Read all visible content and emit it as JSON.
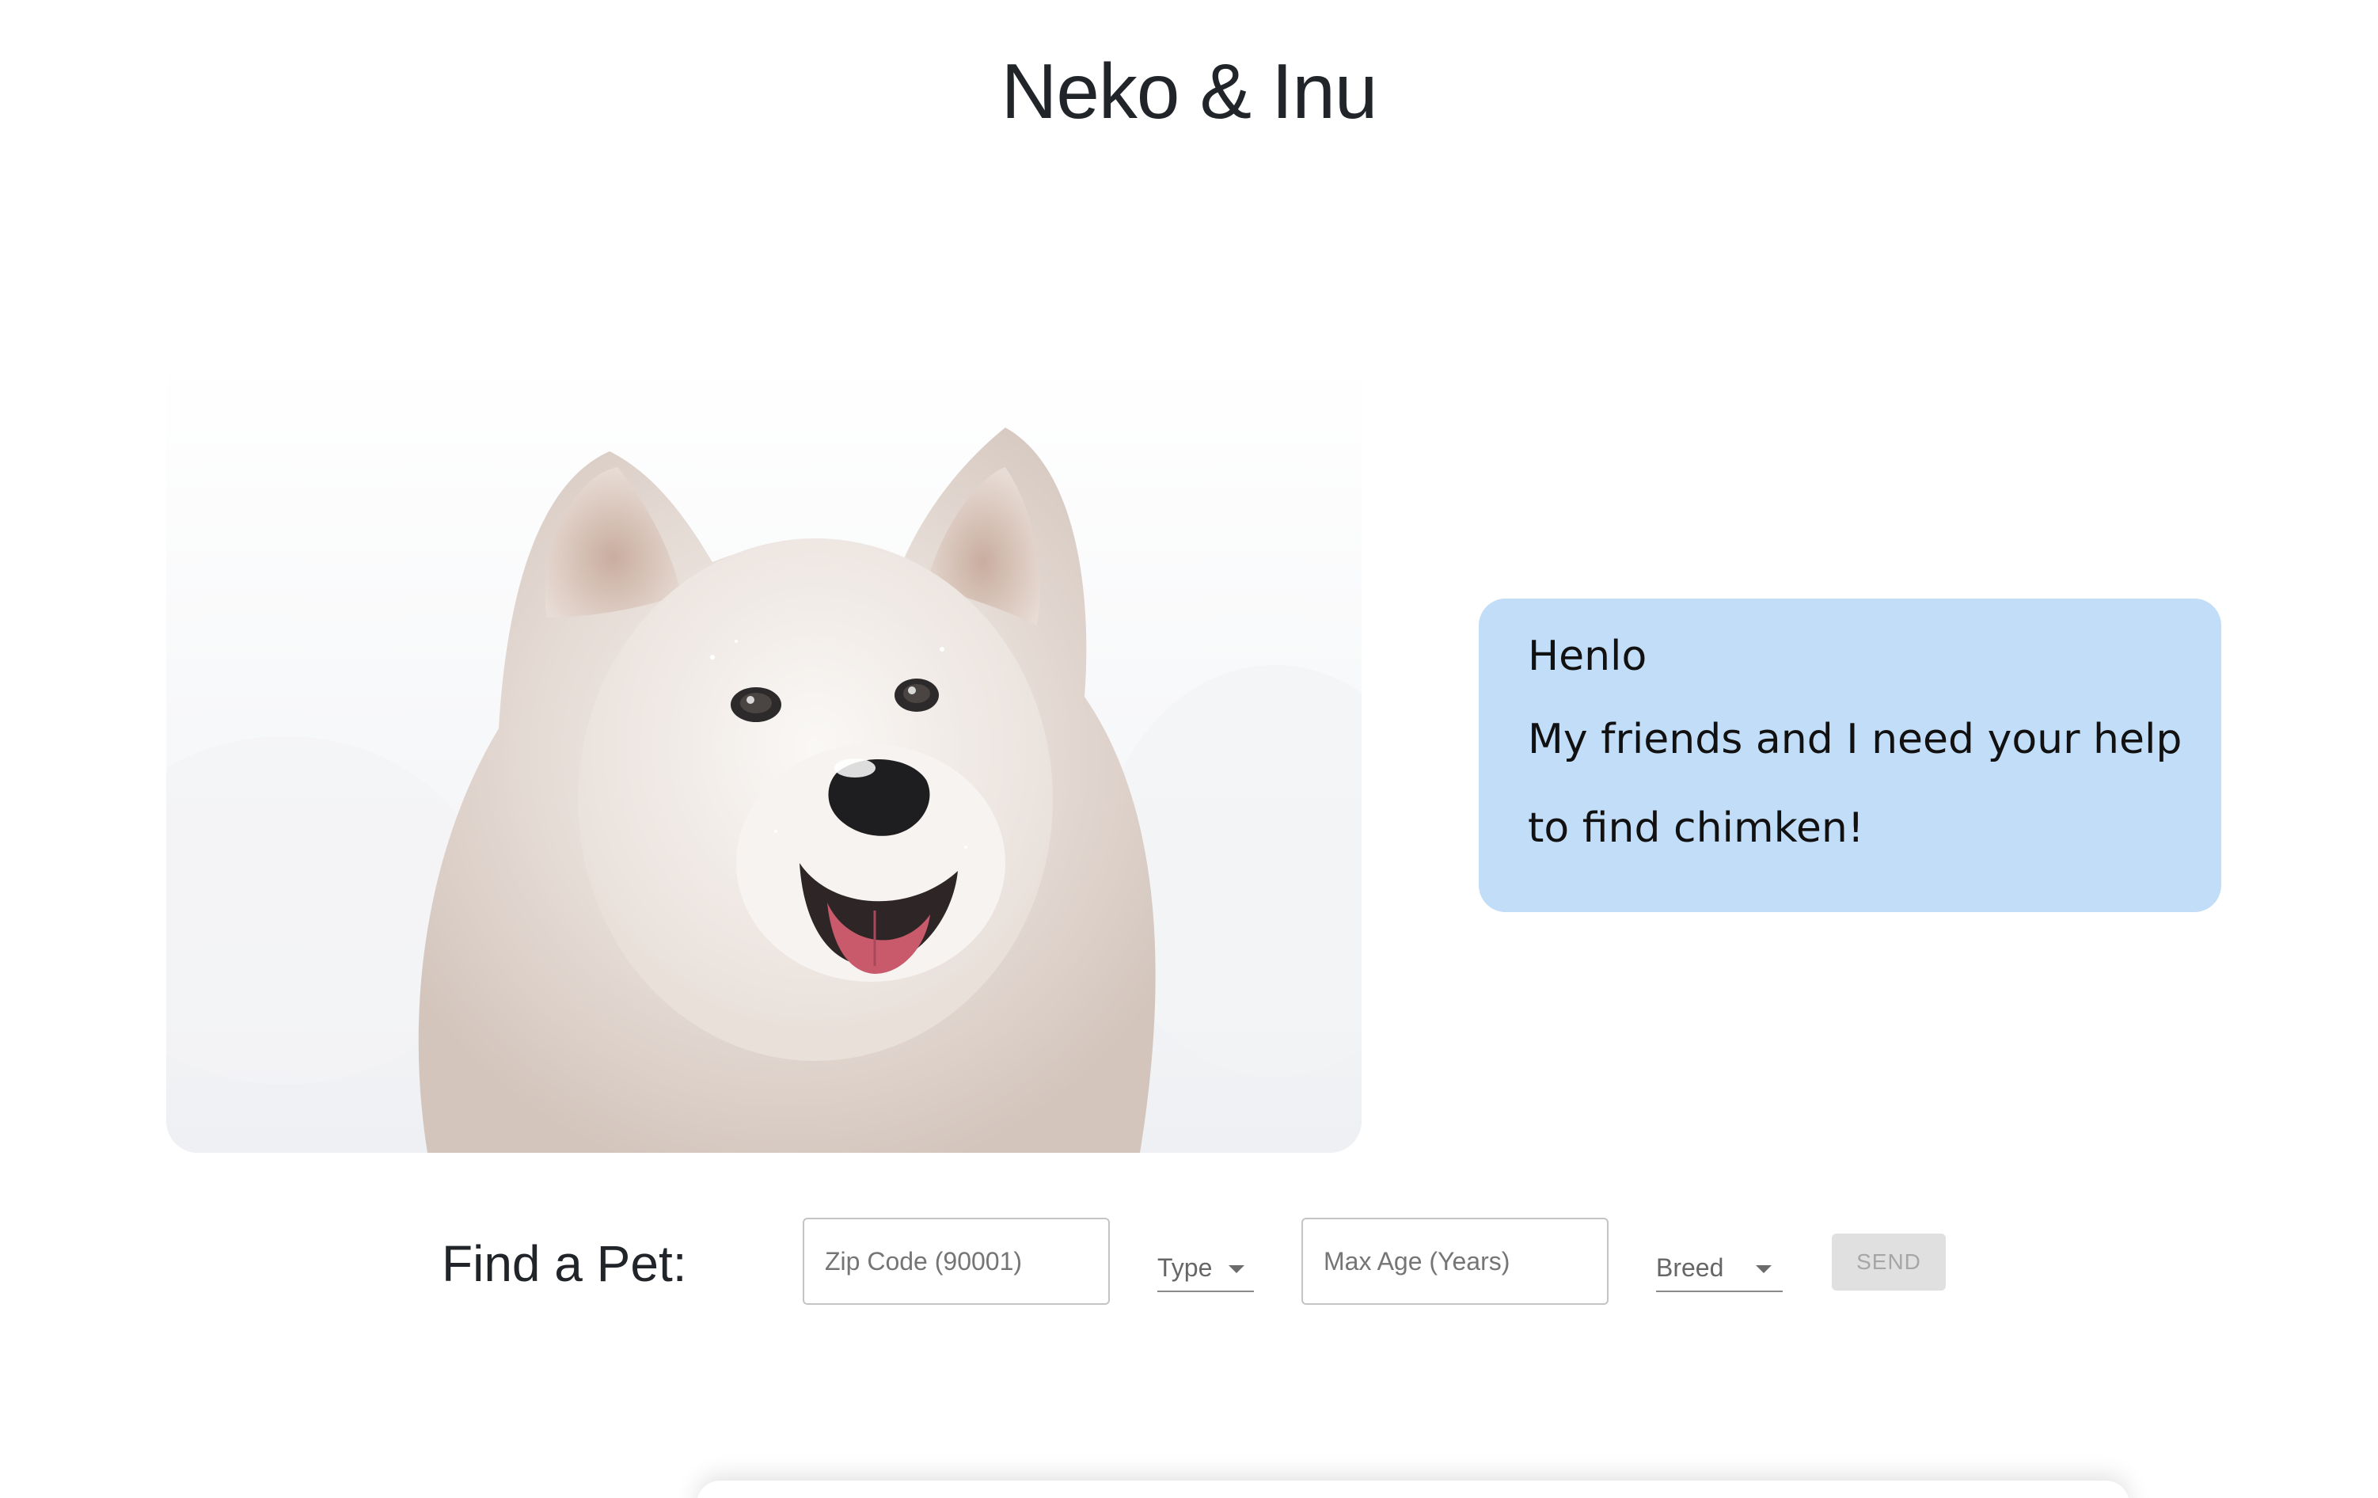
{
  "header": {
    "title": "Neko & Inu"
  },
  "hero": {
    "image": "samoyed-dog-in-snow-photo",
    "speech_bubble": {
      "lines": [
        "Henlo",
        "My friends and I need your help",
        "to find chimken!"
      ],
      "color": "#c2ddf7"
    }
  },
  "search": {
    "label": "Find a Pet:",
    "zip_placeholder": "Zip Code (90001)",
    "type_label": "Type",
    "max_age_placeholder": "Max Age (Years)",
    "breed_label": "Breed",
    "send_label": "SEND"
  }
}
